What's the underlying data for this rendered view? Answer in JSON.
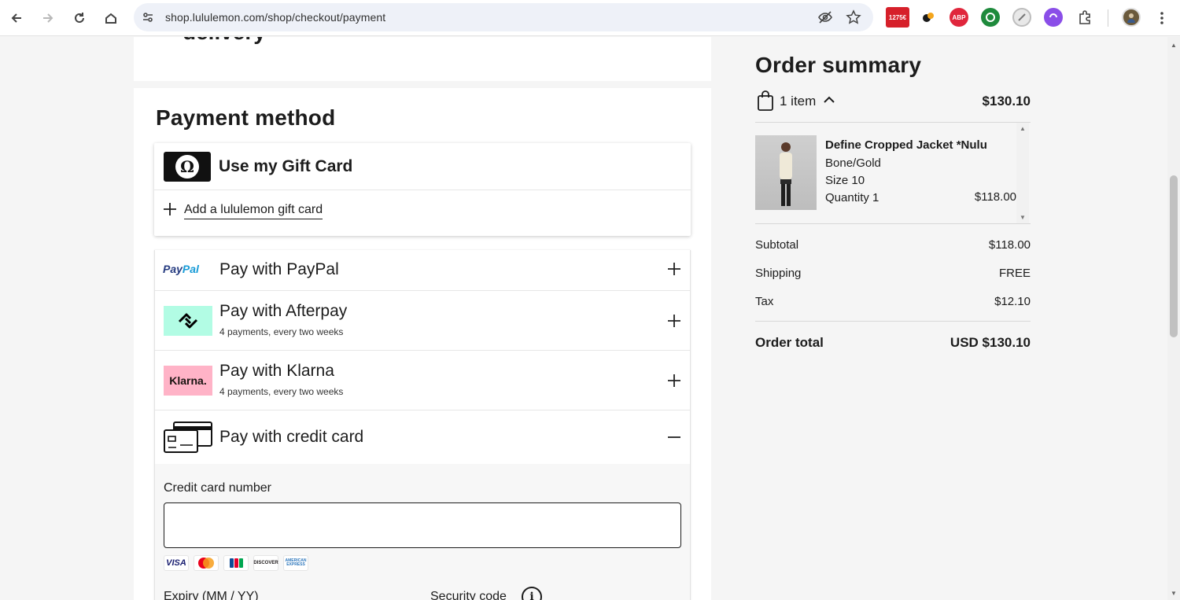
{
  "browser": {
    "url": "shop.lululemon.com/shop/checkout/payment",
    "extensions": [
      {
        "name": "calendar-extension",
        "label": "1275€",
        "color": "#d6202a"
      },
      {
        "name": "brave-like-extension",
        "label": "",
        "color": "#1a1a1a"
      },
      {
        "name": "adblock-plus-extension",
        "label": "ABP",
        "color": "#e0263c"
      },
      {
        "name": "whatsapp-like-extension",
        "label": "",
        "color": "#1e8a3c"
      },
      {
        "name": "gray-circle-extension",
        "label": "",
        "color": "#9a9a9a"
      },
      {
        "name": "purple-extension",
        "label": "",
        "color": "#8a4ee8"
      }
    ]
  },
  "delivery": {
    "title_cut": "delivery"
  },
  "payment": {
    "title": "Payment method",
    "gift_card": {
      "title": "Use my Gift Card",
      "add_label": "Add a lululemon gift card"
    },
    "methods": [
      {
        "id": "paypal",
        "title": "Pay with PayPal",
        "sub": "",
        "toggle": "+",
        "logo_text_a": "Pay",
        "logo_text_b": "Pal"
      },
      {
        "id": "afterpay",
        "title": "Pay with Afterpay",
        "sub": "4 payments, every two weeks",
        "toggle": "+"
      },
      {
        "id": "klarna",
        "title": "Pay with Klarna",
        "sub": "4 payments, every two weeks",
        "toggle": "+",
        "logo_text": "Klarna."
      },
      {
        "id": "credit",
        "title": "Pay with credit card",
        "sub": "",
        "toggle": "−"
      }
    ],
    "credit_card": {
      "number_label": "Credit card number",
      "number_value": "",
      "brands": [
        "VISA",
        "",
        "",
        "DISCOVER",
        "AMERICAN EXPRESS"
      ],
      "expiry_label": "Expiry (MM / YY)",
      "security_label": "Security code"
    }
  },
  "summary": {
    "title": "Order summary",
    "items_count": "1 item",
    "items_total": "$130.10",
    "product": {
      "name": "Define Cropped Jacket *Nulu",
      "color": "Bone/Gold",
      "size": "Size 10",
      "quantity": "Quantity 1",
      "price": "$118.00"
    },
    "lines": [
      {
        "label": "Subtotal",
        "value": "$118.00"
      },
      {
        "label": "Shipping",
        "value": "FREE"
      },
      {
        "label": "Tax",
        "value": "$12.10"
      }
    ],
    "total_label": "Order total",
    "total_value": "USD $130.10"
  }
}
